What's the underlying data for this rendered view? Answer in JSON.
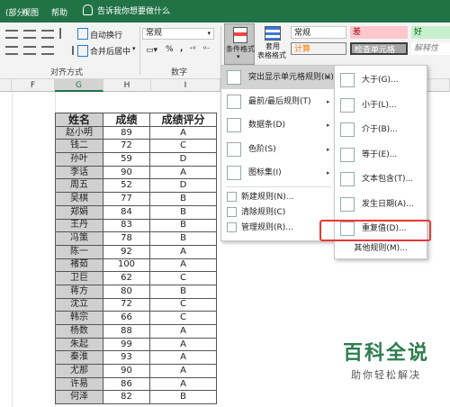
{
  "menubar": {
    "tabs": [
      "(部分)",
      "视图",
      "帮助"
    ],
    "tellme": "告诉我你想要做什么"
  },
  "ribbon": {
    "wrap_text": "自动换行",
    "merge_center": "合并后居中",
    "number_format": "常规",
    "percent": "%",
    "comma": ",",
    "alignment_label": "对齐方式",
    "number_label": "数字",
    "cond_format": "条件格式",
    "table_format_1": "套用",
    "table_format_2": "表格格式",
    "styles": {
      "normal": "常规",
      "bad": "差",
      "good": "好",
      "calc": "计算",
      "check": "检查单元格",
      "explain": "解释性"
    },
    "colors": {
      "ribbon_bg": "#f3f3f3",
      "bad_bg": "#ffc7ce",
      "bad_fg": "#9c0006",
      "good_bg": "#c6efce",
      "good_fg": "#006100",
      "calc_bg": "#f2f2f2",
      "calc_fg": "#fa7d00",
      "check_bg": "#a5a5a5",
      "check_fg": "#ffffff"
    }
  },
  "sheet": {
    "columns": [
      "F",
      "G",
      "H",
      "I"
    ],
    "headers": [
      "姓名",
      "成绩",
      "成绩评分"
    ],
    "rows": [
      [
        "赵小明",
        "89",
        "A"
      ],
      [
        "钱二",
        "72",
        "C"
      ],
      [
        "孙叶",
        "59",
        "D"
      ],
      [
        "李话",
        "90",
        "A"
      ],
      [
        "周五",
        "52",
        "D"
      ],
      [
        "吴棋",
        "77",
        "B"
      ],
      [
        "郑娟",
        "84",
        "B"
      ],
      [
        "王丹",
        "83",
        "B"
      ],
      [
        "冯策",
        "78",
        "B"
      ],
      [
        "陈一",
        "92",
        "A"
      ],
      [
        "褚茹",
        "100",
        "A"
      ],
      [
        "卫巨",
        "62",
        "C"
      ],
      [
        "蒋方",
        "80",
        "B"
      ],
      [
        "沈立",
        "72",
        "C"
      ],
      [
        "韩宗",
        "66",
        "C"
      ],
      [
        "杨数",
        "88",
        "A"
      ],
      [
        "朱起",
        "99",
        "A"
      ],
      [
        "秦淮",
        "93",
        "A"
      ],
      [
        "尤那",
        "90",
        "A"
      ],
      [
        "许易",
        "86",
        "A"
      ],
      [
        "何泽",
        "82",
        "B"
      ]
    ]
  },
  "cf_menu": {
    "items": [
      {
        "label": "突出显示单元格规则(H)",
        "icon": "highlight-cells-icon"
      },
      {
        "label": "最前/最后规则(T)",
        "icon": "top-bottom-icon"
      },
      {
        "label": "数据条(D)",
        "icon": "data-bars-icon"
      },
      {
        "label": "色阶(S)",
        "icon": "color-scales-icon"
      },
      {
        "label": "图标集(I)",
        "icon": "icon-sets-icon"
      }
    ],
    "small_items": [
      {
        "label": "新建规则(N)...",
        "icon": "new-rule-icon"
      },
      {
        "label": "清除规则(C)",
        "icon": "clear-rules-icon"
      },
      {
        "label": "管理规则(R)...",
        "icon": "manage-rules-icon"
      }
    ]
  },
  "highlight_menu": {
    "items": [
      {
        "label": "大于(G)...",
        "icon": "greater-than-icon"
      },
      {
        "label": "小于(L)...",
        "icon": "less-than-icon"
      },
      {
        "label": "介于(B)...",
        "icon": "between-icon"
      },
      {
        "label": "等于(E)...",
        "icon": "equal-to-icon"
      },
      {
        "label": "文本包含(T)...",
        "icon": "text-contains-icon"
      },
      {
        "label": "发生日期(A)...",
        "icon": "date-occurring-icon"
      },
      {
        "label": "重复值(D)...",
        "icon": "duplicate-values-icon"
      }
    ],
    "more": "其他规则(M)...",
    "highlight_color": "#e53935"
  },
  "watermark": {
    "title": "百科全说",
    "subtitle": "助你轻松解决"
  }
}
